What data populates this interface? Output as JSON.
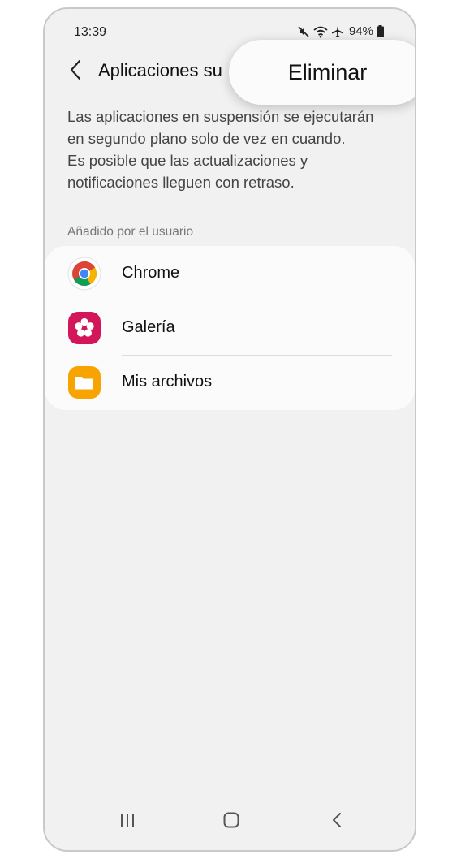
{
  "status": {
    "time": "13:39",
    "battery": "94%",
    "icons": [
      "mute-icon",
      "wifi-icon",
      "airplane-icon",
      "battery-icon"
    ]
  },
  "header": {
    "title": "Aplicaciones su",
    "back_icon": "chevron-left-icon"
  },
  "menu": {
    "item": "Eliminar"
  },
  "description": {
    "lines": [
      "Las aplicaciones en suspensión se ejecutarán",
      "en segundo plano solo de vez en cuando.",
      "Es posible que las actualizaciones y",
      "notificaciones lleguen con retraso."
    ]
  },
  "section": {
    "header": "Añadido por el usuario"
  },
  "apps": [
    {
      "label": "Chrome",
      "icon": "chrome-icon"
    },
    {
      "label": "Galería",
      "icon": "gallery-icon"
    },
    {
      "label": "Mis archivos",
      "icon": "my-files-icon"
    }
  ],
  "navbar": {
    "icons": [
      "recents-icon",
      "home-icon",
      "back-nav-icon"
    ]
  },
  "colors": {
    "background": "#f1f1f1",
    "card": "#fbfbfb",
    "gallery": "#d3155a",
    "files": "#f7a300"
  }
}
